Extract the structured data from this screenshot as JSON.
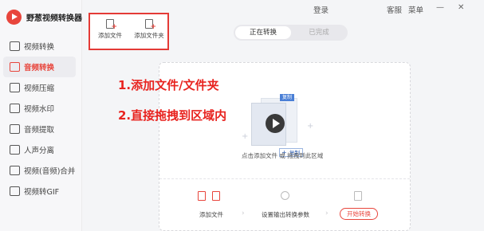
{
  "app": {
    "name": "野葱视频转换器"
  },
  "nav": [
    {
      "label": "视频转换",
      "icon": "video-convert-icon"
    },
    {
      "label": "音频转换",
      "icon": "audio-convert-icon",
      "active": true
    },
    {
      "label": "视频压缩",
      "icon": "video-compress-icon"
    },
    {
      "label": "视频水印",
      "icon": "watermark-icon"
    },
    {
      "label": "音频提取",
      "icon": "audio-extract-icon"
    },
    {
      "label": "人声分离",
      "icon": "vocal-separate-icon"
    },
    {
      "label": "视频(音频)合并",
      "icon": "merge-icon"
    },
    {
      "label": "视频转GIF",
      "icon": "gif-icon"
    }
  ],
  "topbar": {
    "login": "登录",
    "service": "客服",
    "menu": "菜单",
    "minimize": "—",
    "close": "✕"
  },
  "tools": {
    "add_file": "添加文件",
    "add_folder": "添加文件夹"
  },
  "tabs": {
    "converting": "正在转换",
    "done": "已完成"
  },
  "annotations": {
    "line1": "1.添加文件/文件夹",
    "line2": "2.直接拖拽到区域内"
  },
  "drop": {
    "hint": "点击添加文件 或 拖拽到此区域",
    "copy_tag": "复制",
    "corner_tag": "复制"
  },
  "steps": {
    "add_file": "添加文件",
    "set_params": "设置输出转换参数",
    "start": "开始转换"
  },
  "colors": {
    "accent": "#e8453c",
    "highlight_border": "#e43a36",
    "annotation": "#e8231f"
  }
}
